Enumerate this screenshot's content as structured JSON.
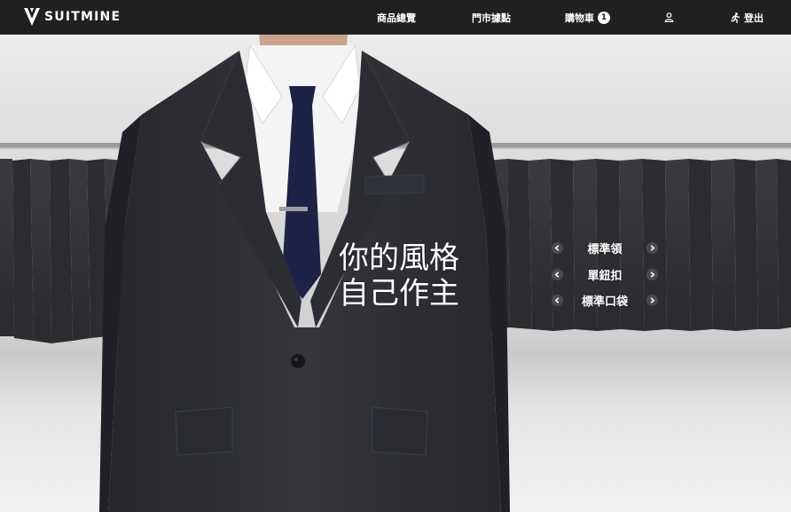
{
  "brand": {
    "name": "SUITMINE",
    "logo_icon": "v-suit-logo-icon"
  },
  "nav": {
    "products": "商品總覽",
    "stores": "門市據點",
    "cart": "購物車",
    "cart_count": "1",
    "account_icon": "user-icon",
    "logout_icon": "running-person-icon",
    "logout": "登出"
  },
  "hero": {
    "tagline_line1": "你的風格",
    "tagline_line2": "自己作主",
    "options": [
      {
        "label": "標準領"
      },
      {
        "label": "單鈕扣"
      },
      {
        "label": "標準口袋"
      }
    ],
    "prev_icon": "chevron-left-icon",
    "next_icon": "chevron-right-icon"
  },
  "colors": {
    "nav_background": "#1f2022",
    "suit": "#2e3036",
    "tie": "#1d2346",
    "shirt": "#f4f4f4"
  }
}
